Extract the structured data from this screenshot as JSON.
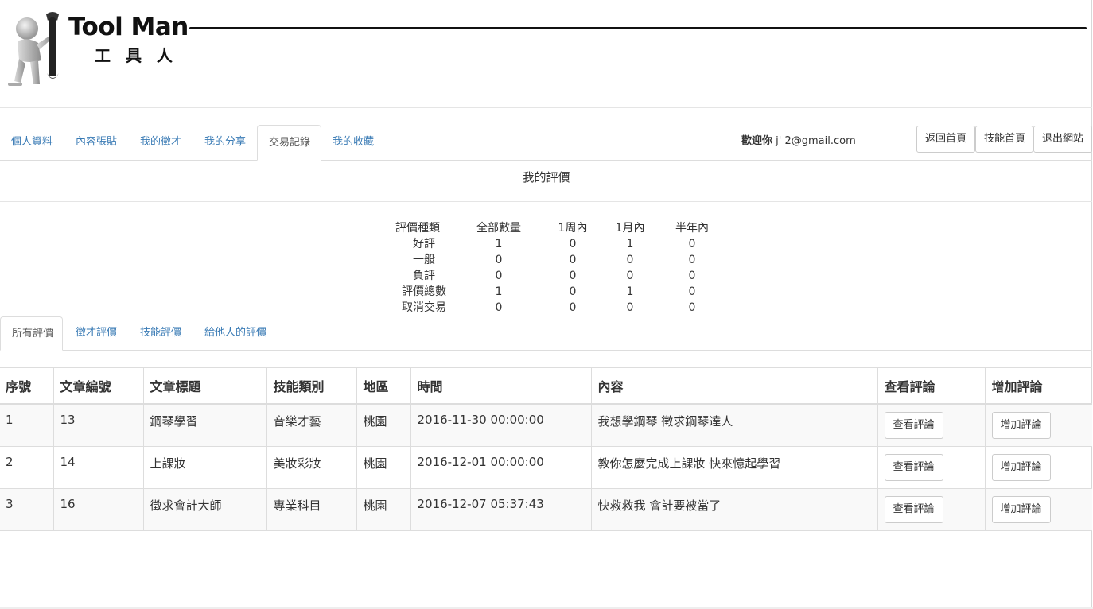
{
  "logo": {
    "title": "Tool Man",
    "subtitle": "工 具 人"
  },
  "nav": {
    "tabs": [
      "個人資料",
      "內容張貼",
      "我的徵才",
      "我的分享",
      "交易記錄",
      "我的收藏"
    ],
    "active_index": 4,
    "welcome_label": "歡迎你",
    "welcome_email": "j'        2@gmail.com",
    "buttons": {
      "home": "返回首頁",
      "skill": "技能首頁",
      "logout": "退出網站"
    }
  },
  "section_title": "我的評價",
  "stats": {
    "headers": [
      "評價種類",
      "全部數量",
      "1周內",
      "1月內",
      "半年內"
    ],
    "rows": [
      [
        "好評",
        "1",
        "0",
        "1",
        "0"
      ],
      [
        "一般",
        "0",
        "0",
        "0",
        "0"
      ],
      [
        "負評",
        "0",
        "0",
        "0",
        "0"
      ],
      [
        "評價總數",
        "1",
        "0",
        "1",
        "0"
      ],
      [
        "取消交易",
        "0",
        "0",
        "0",
        "0"
      ]
    ]
  },
  "sub_tabs": {
    "items": [
      "所有評價",
      "徵才評價",
      "技能評價",
      "給他人的評價"
    ],
    "active_index": 0
  },
  "table": {
    "headers": [
      "序號",
      "文章編號",
      "文章標題",
      "技能類別",
      "地區",
      "時間",
      "內容",
      "查看評論",
      "增加評論"
    ],
    "rows": [
      {
        "no": "1",
        "article_id": "13",
        "title": "鋼琴學習",
        "category": "音樂才藝",
        "region": "桃園",
        "time": "2016-11-30 00:00:00",
        "content": "我想學鋼琴 徵求鋼琴達人",
        "view": "查看評論",
        "add": "增加評論"
      },
      {
        "no": "2",
        "article_id": "14",
        "title": "上課妝",
        "category": "美妝彩妝",
        "region": "桃園",
        "time": "2016-12-01 00:00:00",
        "content": "教你怎麼完成上課妝 快來憶起學習",
        "view": "查看評論",
        "add": "增加評論"
      },
      {
        "no": "3",
        "article_id": "16",
        "title": "徵求會計大師",
        "category": "專業科目",
        "region": "桃園",
        "time": "2016-12-07 05:37:43",
        "content": "快救救我 會計要被當了",
        "view": "查看評論",
        "add": "增加評論"
      }
    ]
  }
}
